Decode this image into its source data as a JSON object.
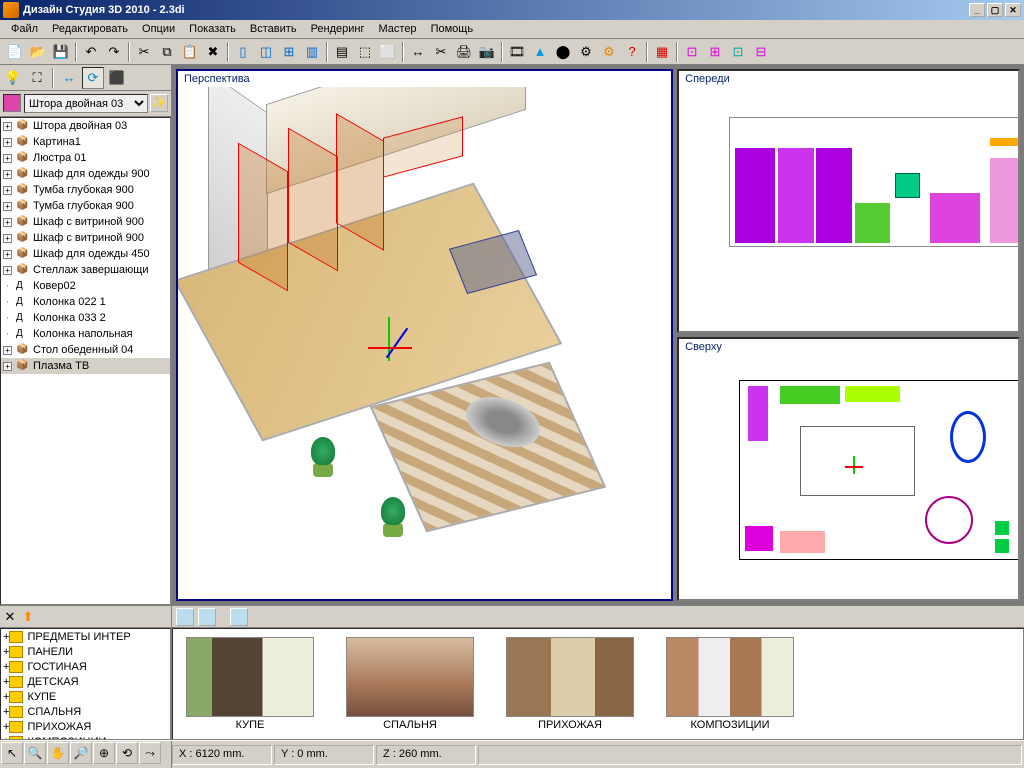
{
  "window": {
    "title": "Дизайн Студия 3D 2010 - 2.3di"
  },
  "menu": [
    "Файл",
    "Редактировать",
    "Опции",
    "Показать",
    "Вставить",
    "Рендеринг",
    "Мастер",
    "Помощь"
  ],
  "combo": {
    "selected": "Штора двойная 03"
  },
  "scene_tree": [
    {
      "exp": "+",
      "t": "Штора двойная 03"
    },
    {
      "exp": "+",
      "t": "Картина1"
    },
    {
      "exp": "+",
      "t": "Люстра 01"
    },
    {
      "exp": "+",
      "t": "Шкаф для одежды 900"
    },
    {
      "exp": "+",
      "t": "Тумба глубокая 900"
    },
    {
      "exp": "+",
      "t": "Тумба глубокая 900"
    },
    {
      "exp": "+",
      "t": "Шкаф с витриной 900"
    },
    {
      "exp": "+",
      "t": "Шкаф с витриной 900"
    },
    {
      "exp": "+",
      "t": "Шкаф для одежды 450"
    },
    {
      "exp": "+",
      "t": "Стеллаж завершающи"
    },
    {
      "exp": "-",
      "t": "Ковер02",
      "leaf": true
    },
    {
      "exp": "-",
      "t": "Колонка 022 1",
      "leaf": true
    },
    {
      "exp": "-",
      "t": "Колонка 033 2",
      "leaf": true
    },
    {
      "exp": "-",
      "t": "Колонка напольная",
      "leaf": true
    },
    {
      "exp": "+",
      "t": "Стол обеденный 04"
    },
    {
      "exp": "+",
      "t": "Плазма ТВ",
      "sel": true
    }
  ],
  "viewports": {
    "perspective": "Перспектива",
    "front": "Спереди",
    "top": "Сверху"
  },
  "categories": [
    "ПРЕДМЕТЫ ИНТЕР",
    "ПАНЕЛИ",
    "ГОСТИНАЯ",
    "ДЕТСКАЯ",
    "КУПЕ",
    "СПАЛЬНЯ",
    "ПРИХОЖАЯ",
    "КОМПОЗИЦИИ"
  ],
  "thumbs": [
    "КУПЕ",
    "СПАЛЬНЯ",
    "ПРИХОЖАЯ",
    "КОМПОЗИЦИИ"
  ],
  "status": {
    "x": "X : 6120 mm.",
    "y": "Y : 0 mm.",
    "z": "Z : 260 mm."
  }
}
